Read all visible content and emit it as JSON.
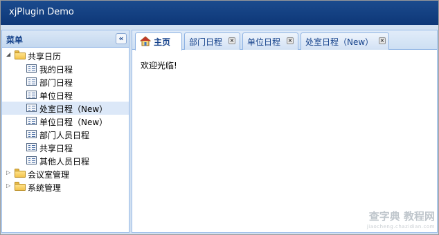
{
  "app": {
    "title": "xjPlugin Demo"
  },
  "west": {
    "title": "菜单",
    "collapse_symbol": "«",
    "tree": {
      "root": {
        "label": "共享日历",
        "expanded": true
      },
      "children": [
        {
          "label": "我的日程"
        },
        {
          "label": "部门日程"
        },
        {
          "label": "单位日程"
        },
        {
          "label": "处室日程（New）",
          "selected": true
        },
        {
          "label": "单位日程（New）"
        },
        {
          "label": "部门人员日程"
        },
        {
          "label": "共享日程"
        },
        {
          "label": "其他人员日程"
        }
      ],
      "folders": [
        {
          "label": "会议室管理",
          "expanded": false
        },
        {
          "label": "系统管理",
          "expanded": false
        }
      ]
    }
  },
  "tabs": [
    {
      "label": "主页",
      "active": true,
      "icon": "home-icon"
    },
    {
      "label": "部门日程",
      "closable": true
    },
    {
      "label": "单位日程",
      "closable": true
    },
    {
      "label": "处室日程（New）",
      "closable": true
    }
  ],
  "tab_close_symbol": "×",
  "content": {
    "welcome": "欢迎光临!"
  },
  "watermark": {
    "main": "查字典 教程网",
    "sub": "jiaocheng.chazidian.com"
  },
  "colors": {
    "titlebar": "#15428b",
    "panel_border": "#99bbe8",
    "selected_row": "#dce8f8"
  }
}
